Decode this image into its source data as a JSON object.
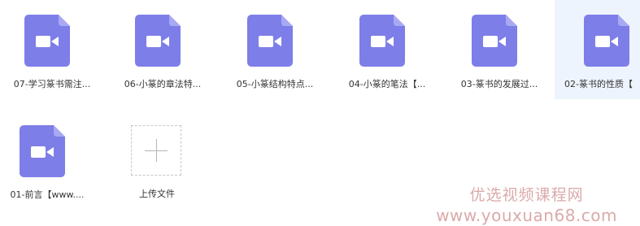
{
  "files": [
    {
      "name": "07-学习篆书需注..."
    },
    {
      "name": "06-小篆的章法特..."
    },
    {
      "name": "05-小篆结构特点..."
    },
    {
      "name": "04-小篆的笔法【..."
    },
    {
      "name": "03-篆书的发展过..."
    },
    {
      "name": "02-篆书的性质【"
    },
    {
      "name": "01-前言【www...."
    }
  ],
  "upload": {
    "label": "上传文件"
  },
  "watermark": {
    "line1": "优选视频课程网",
    "line2": "www.youxuan68.com"
  },
  "colors": {
    "icon": "#7e7ee8",
    "icon_fold": "#a9a9f3",
    "selected_bg": "#eef4fd"
  }
}
